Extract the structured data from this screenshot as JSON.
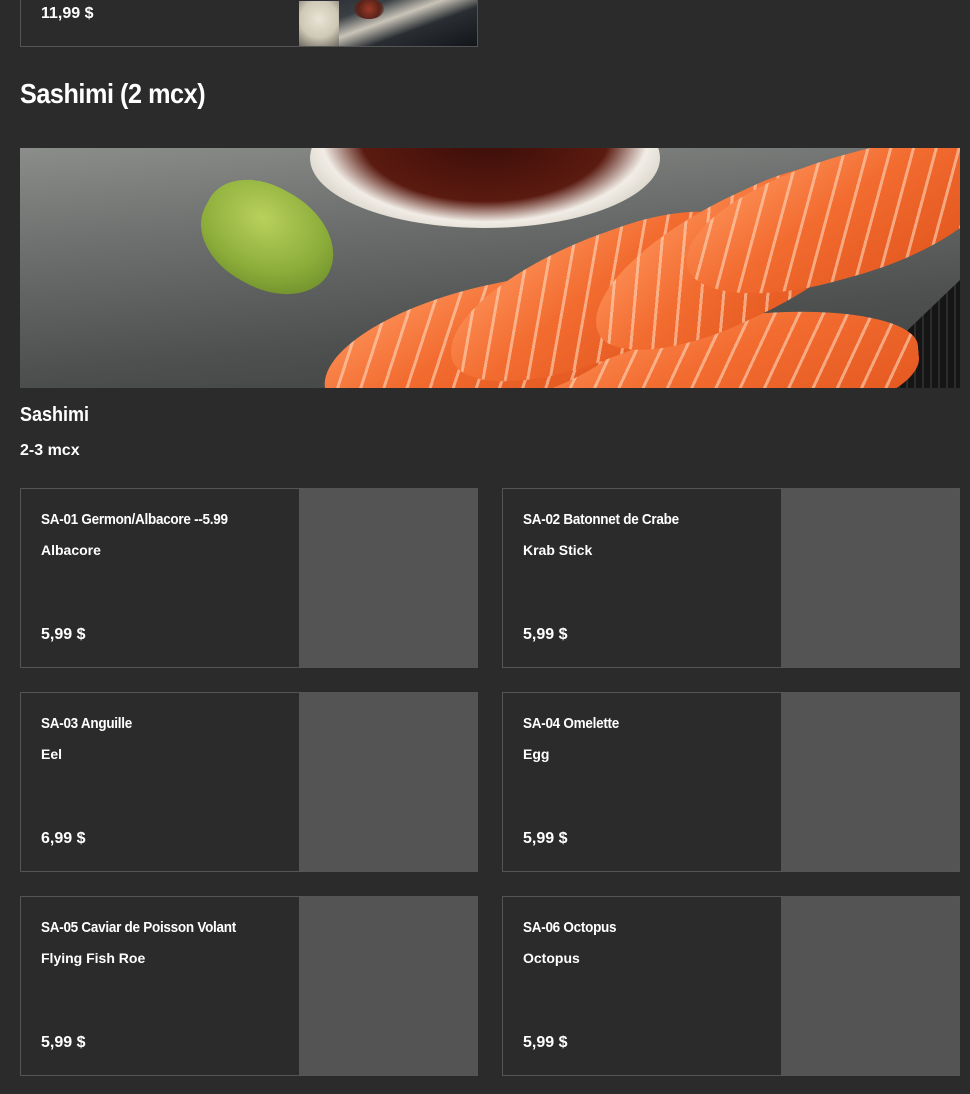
{
  "top_item": {
    "price": "11,99 $"
  },
  "section": {
    "title": "Sashimi (2 mcx)"
  },
  "group": {
    "title": "Sashimi",
    "subtitle": "2-3 mcx"
  },
  "items": [
    {
      "name": "SA-01 Germon/Albacore --5.99",
      "desc": "Albacore",
      "price": "5,99 $"
    },
    {
      "name": "SA-02 Batonnet de Crabe",
      "desc": "Krab Stick",
      "price": "5,99 $"
    },
    {
      "name": "SA-03 Anguille",
      "desc": "Eel",
      "price": "6,99 $"
    },
    {
      "name": "SA-04 Omelette",
      "desc": "Egg",
      "price": "5,99 $"
    },
    {
      "name": "SA-05 Caviar de Poisson Volant",
      "desc": "Flying Fish Roe",
      "price": "5,99 $"
    },
    {
      "name": "SA-06 Octopus",
      "desc": "Octopus",
      "price": "5,99 $"
    }
  ],
  "colors": {
    "background": "#2b2b2b",
    "card_border": "#555555",
    "placeholder": "#545454",
    "text": "#ffffff"
  }
}
